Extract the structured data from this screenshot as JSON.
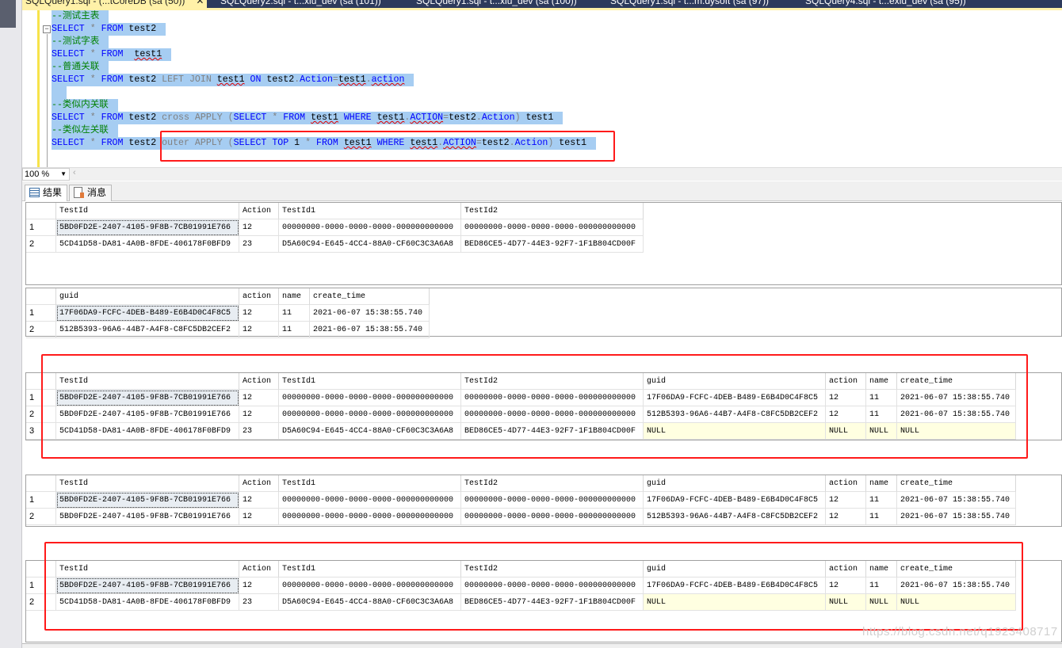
{
  "doc_tabs": [
    {
      "label": "SQLQuery1.sql - (...tCoreDB (sa (50))",
      "active": true,
      "close": "✕"
    },
    {
      "label": "SQLQuery2.sql - t...xiu_dev (sa (101))"
    },
    {
      "label": "SQLQuery1.sql - t...xiu_dev (sa (100))"
    },
    {
      "label": "SQLQuery1.sql - t...m.dysoft (sa (97))"
    },
    {
      "label": "SQLQuery4.sql - t...exiu_dev (sa (95))"
    }
  ],
  "editor": {
    "fold": "−",
    "lines": [
      [
        [
          "--测试主表",
          "c"
        ]
      ],
      [
        [
          "SELECT",
          "k"
        ],
        [
          " * ",
          "g"
        ],
        [
          "FROM",
          "k"
        ],
        [
          " test2",
          "t"
        ]
      ],
      [
        [
          "--测试字表",
          "c"
        ]
      ],
      [
        [
          "SELECT",
          "k"
        ],
        [
          " * ",
          "g"
        ],
        [
          "FROM",
          "k"
        ],
        [
          "  ",
          "t"
        ],
        [
          "test1",
          "t sq"
        ]
      ],
      [
        [
          "--普通关联",
          "c"
        ]
      ],
      [
        [
          "SELECT",
          "k"
        ],
        [
          " * ",
          "g"
        ],
        [
          "FROM",
          "k"
        ],
        [
          " test2 ",
          "t"
        ],
        [
          "LEFT JOIN",
          "g"
        ],
        [
          " ",
          "t"
        ],
        [
          "test1",
          "t sq"
        ],
        [
          " ",
          "t"
        ],
        [
          "ON",
          "k"
        ],
        [
          " test2",
          "t"
        ],
        [
          ".",
          "g"
        ],
        [
          "Action",
          "k"
        ],
        [
          "=",
          "g"
        ],
        [
          "test1",
          "t sq"
        ],
        [
          ".",
          "g"
        ],
        [
          "action",
          "k sq"
        ]
      ],
      [
        [
          " ",
          "t"
        ]
      ],
      [
        [
          "--类似内关联",
          "c"
        ]
      ],
      [
        [
          "SELECT",
          "k"
        ],
        [
          " * ",
          "g"
        ],
        [
          "FROM",
          "k"
        ],
        [
          " test2 ",
          "t"
        ],
        [
          "cross APPLY (",
          "g"
        ],
        [
          "SELECT",
          "k"
        ],
        [
          " * ",
          "g"
        ],
        [
          "FROM",
          "k"
        ],
        [
          " ",
          "t"
        ],
        [
          "test1",
          "t sq"
        ],
        [
          " ",
          "t"
        ],
        [
          "WHERE",
          "k"
        ],
        [
          " ",
          "t"
        ],
        [
          "test1",
          "t sq"
        ],
        [
          ".",
          "g"
        ],
        [
          "ACTION",
          "k sq"
        ],
        [
          "=",
          "g"
        ],
        [
          "test2",
          "t"
        ],
        [
          ".",
          "g"
        ],
        [
          "Action",
          "k"
        ],
        [
          ")",
          "g"
        ],
        [
          " test1",
          "t"
        ]
      ],
      [
        [
          "--类似左关联",
          "c"
        ]
      ],
      [
        [
          "SELECT",
          "k"
        ],
        [
          " * ",
          "g"
        ],
        [
          "FROM",
          "k"
        ],
        [
          " test2 ",
          "t"
        ],
        [
          "outer APPLY (",
          "g"
        ],
        [
          "SELECT",
          "k"
        ],
        [
          " ",
          "t"
        ],
        [
          "TOP",
          "k"
        ],
        [
          " 1 ",
          "t"
        ],
        [
          "* ",
          "g"
        ],
        [
          "FROM",
          "k"
        ],
        [
          " ",
          "t"
        ],
        [
          "test1",
          "t sq"
        ],
        [
          " ",
          "t"
        ],
        [
          "WHERE",
          "k"
        ],
        [
          " ",
          "t"
        ],
        [
          "test1",
          "t sq"
        ],
        [
          ".",
          "g"
        ],
        [
          "ACTION",
          "k sq"
        ],
        [
          "=",
          "g"
        ],
        [
          "test2",
          "t"
        ],
        [
          ".",
          "g"
        ],
        [
          "Action",
          "k"
        ],
        [
          ")",
          "g"
        ],
        [
          " test1",
          "t"
        ]
      ]
    ]
  },
  "zoom": {
    "value": "100 %",
    "arrow": "▼",
    "scroll": "‹"
  },
  "result_tabs": [
    {
      "label": "结果",
      "icon": "grid-icon"
    },
    {
      "label": "消息",
      "icon": "message-icon"
    }
  ],
  "grids": [
    {
      "columns": [
        "TestId",
        "Action",
        "TestId1",
        "TestId2"
      ],
      "rows": [
        [
          "5BD0FD2E-2407-4105-9F8B-7CB01991E766",
          "12",
          "00000000-0000-0000-0000-000000000000",
          "00000000-0000-0000-0000-000000000000"
        ],
        [
          "5CD41D58-DA81-4A0B-8FDE-406178F0BFD9",
          "23",
          "D5A60C94-E645-4CC4-88A0-CF60C3C3A6A8",
          "BED86CE5-4D77-44E3-92F7-1F1B804CD00F"
        ]
      ]
    },
    {
      "columns": [
        "guid",
        "action",
        "name",
        "create_time"
      ],
      "rows": [
        [
          "17F06DA9-FCFC-4DEB-B489-E6B4D0C4F8C5",
          "12",
          "11",
          "2021-06-07 15:38:55.740"
        ],
        [
          "512B5393-96A6-44B7-A4F8-C8FC5DB2CEF2",
          "12",
          "11",
          "2021-06-07 15:38:55.740"
        ]
      ]
    },
    {
      "columns": [
        "TestId",
        "Action",
        "TestId1",
        "TestId2",
        "guid",
        "action",
        "name",
        "create_time"
      ],
      "rows": [
        [
          "5BD0FD2E-2407-4105-9F8B-7CB01991E766",
          "12",
          "00000000-0000-0000-0000-000000000000",
          "00000000-0000-0000-0000-000000000000",
          "17F06DA9-FCFC-4DEB-B489-E6B4D0C4F8C5",
          "12",
          "11",
          "2021-06-07 15:38:55.740"
        ],
        [
          "5BD0FD2E-2407-4105-9F8B-7CB01991E766",
          "12",
          "00000000-0000-0000-0000-000000000000",
          "00000000-0000-0000-0000-000000000000",
          "512B5393-96A6-44B7-A4F8-C8FC5DB2CEF2",
          "12",
          "11",
          "2021-06-07 15:38:55.740"
        ],
        [
          "5CD41D58-DA81-4A0B-8FDE-406178F0BFD9",
          "23",
          "D5A60C94-E645-4CC4-88A0-CF60C3C3A6A8",
          "BED86CE5-4D77-44E3-92F7-1F1B804CD00F",
          "NULL",
          "NULL",
          "NULL",
          "NULL"
        ]
      ]
    },
    {
      "columns": [
        "TestId",
        "Action",
        "TestId1",
        "TestId2",
        "guid",
        "action",
        "name",
        "create_time"
      ],
      "rows": [
        [
          "5BD0FD2E-2407-4105-9F8B-7CB01991E766",
          "12",
          "00000000-0000-0000-0000-000000000000",
          "00000000-0000-0000-0000-000000000000",
          "17F06DA9-FCFC-4DEB-B489-E6B4D0C4F8C5",
          "12",
          "11",
          "2021-06-07 15:38:55.740"
        ],
        [
          "5BD0FD2E-2407-4105-9F8B-7CB01991E766",
          "12",
          "00000000-0000-0000-0000-000000000000",
          "00000000-0000-0000-0000-000000000000",
          "512B5393-96A6-44B7-A4F8-C8FC5DB2CEF2",
          "12",
          "11",
          "2021-06-07 15:38:55.740"
        ]
      ]
    },
    {
      "columns": [
        "TestId",
        "Action",
        "TestId1",
        "TestId2",
        "guid",
        "action",
        "name",
        "create_time"
      ],
      "rows": [
        [
          "5BD0FD2E-2407-4105-9F8B-7CB01991E766",
          "12",
          "00000000-0000-0000-0000-000000000000",
          "00000000-0000-0000-0000-000000000000",
          "17F06DA9-FCFC-4DEB-B489-E6B4D0C4F8C5",
          "12",
          "11",
          "2021-06-07 15:38:55.740"
        ],
        [
          "5CD41D58-DA81-4A0B-8FDE-406178F0BFD9",
          "23",
          "D5A60C94-E645-4CC4-88A0-CF60C3C3A6A8",
          "BED86CE5-4D77-44E3-92F7-1F1B804CD00F",
          "NULL",
          "NULL",
          "NULL",
          "NULL"
        ]
      ]
    }
  ],
  "watermark": "https://blog.csdn.net/q1923408717",
  "colors": {
    "annotation_box": "#ff1a1a",
    "selection": "#a6cdf2",
    "null_cell": "#ffffe1",
    "keyword": "#0000ff",
    "comment": "#008000"
  }
}
